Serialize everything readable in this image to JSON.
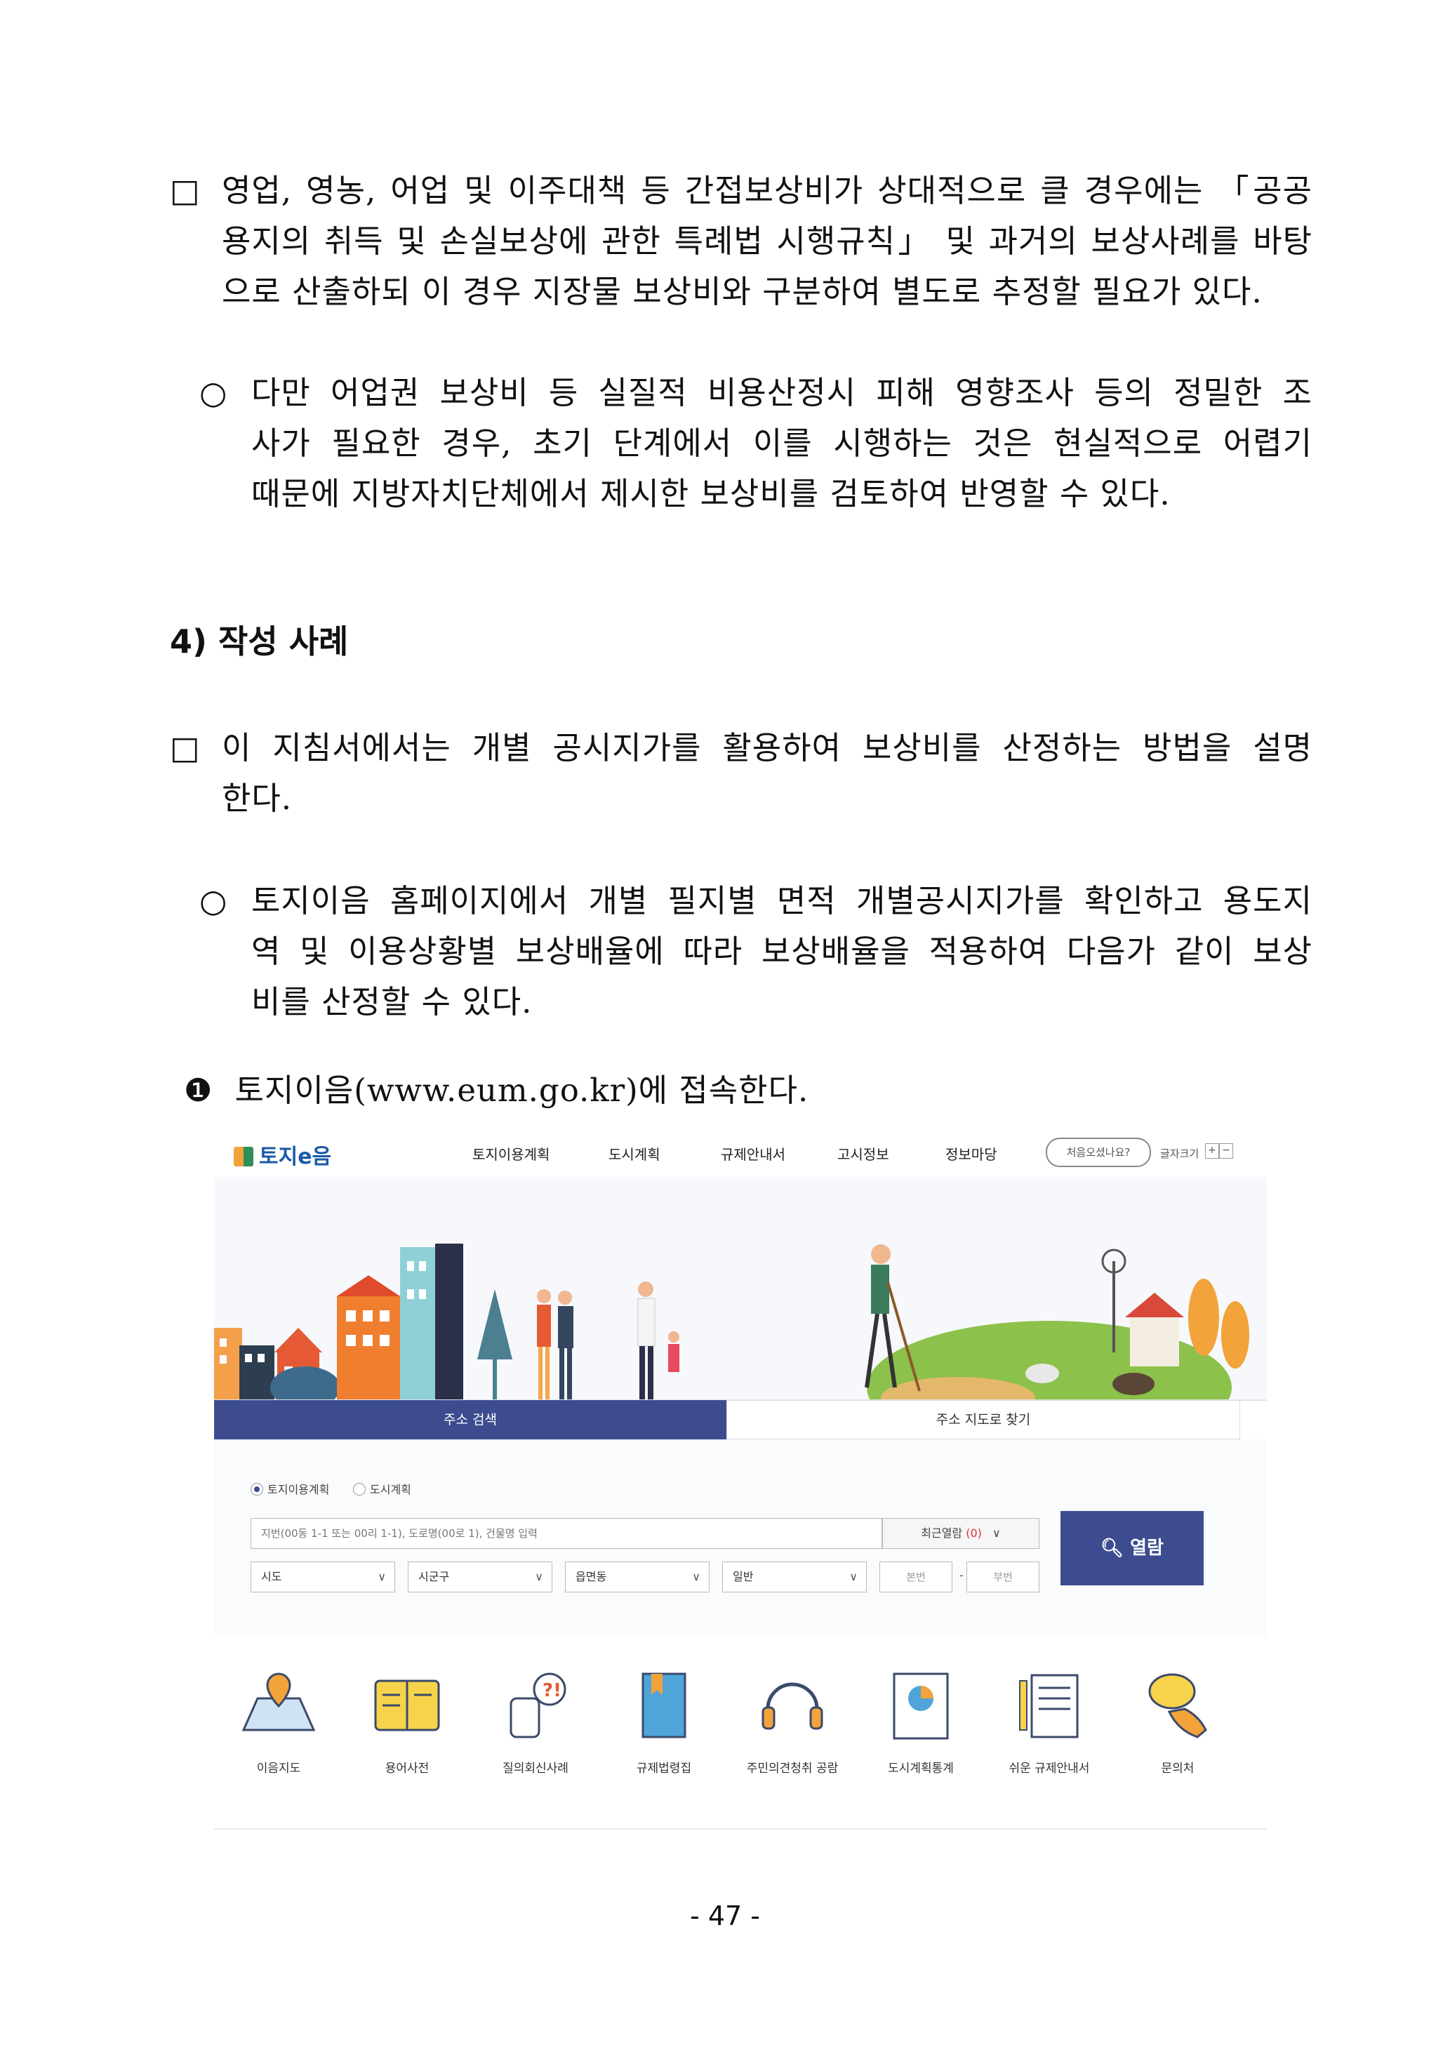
{
  "doc": {
    "p1_mark": "□",
    "p1_lines": [
      "영업, 영농, 어업 및 이주대책 등 간접보상비가 상대적으로 클 경우에는 「공공",
      "용지의 취득 및 손실보상에 관한 특례법 시행규칙」 및 과거의 보상사례를 바탕",
      "으로 산출하되 이 경우 지장물 보상비와 구분하여 별도로 추정할 필요가 있다."
    ],
    "p2_mark": "○",
    "p2_lines": [
      "다만 어업권 보상비 등 실질적 비용산정시 피해 영향조사 등의 정밀한 조",
      "사가 필요한 경우, 초기 단계에서 이를 시행하는 것은 현실적으로 어렵기",
      "때문에 지방자치단체에서 제시한 보상비를 검토하여 반영할 수 있다."
    ],
    "heading": "4) 작성 사례",
    "p3_mark": "□",
    "p3_lines": [
      "이 지침서에서는 개별 공시지가를 활용하여 보상비를 산정하는 방법을 설명",
      "한다."
    ],
    "p4_mark": "○",
    "p4_lines": [
      "토지이음 홈페이지에서 개별 필지별 면적 개별공시지가를 확인하고 용도지",
      "역 및 이용상황별 보상배율에 따라 보상배율을 적용하여 다음가 같이 보상",
      "비를 산정할 수 있다."
    ],
    "step_mark": "❶",
    "step_text": "토지이음(www.eum.go.kr)에 접속한다.",
    "page_number": "- 47 -"
  },
  "site": {
    "logo_text": "토지e음",
    "nav": [
      "토지이용계획",
      "도시계획",
      "규제안내서",
      "고시정보",
      "정보마당"
    ],
    "first_visit": "처음오셨나요?",
    "font_size_label": "글자크기",
    "font_plus": "+",
    "font_minus": "−",
    "tab_address_search": "주소 검색",
    "tab_map_search": "주소 지도로 찾기",
    "radio_land": "토지이용계획",
    "radio_city": "도시계획",
    "address_placeholder": "지번(00동 1-1 또는 00리 1-1), 도로명(00로 1), 건물명 입력",
    "recent_label": "최근열람",
    "recent_count": "(0)",
    "select_sido": "시도",
    "select_sigungu": "시군구",
    "select_eup": "읍면동",
    "select_general": "일반",
    "main_no": "본번",
    "dash": "-",
    "sub_no": "부번",
    "view_button": "열람",
    "quick_links": [
      "이음지도",
      "용어사전",
      "질의회신사례",
      "규제법령집",
      "주민의견청취 공람",
      "도시계획통계",
      "쉬운 규제안내서",
      "문의처"
    ],
    "colors": {
      "primary": "#3d4c8f",
      "logo": "#1a5aa6"
    }
  }
}
